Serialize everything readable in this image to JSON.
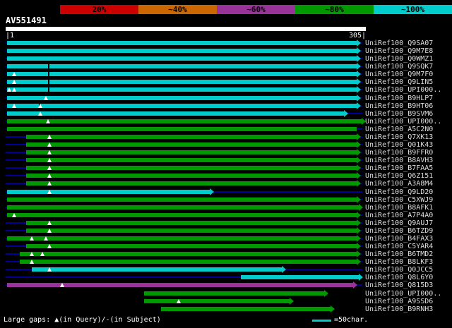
{
  "query": {
    "name": "AV551491",
    "start_label": "|1",
    "end_label": "305|"
  },
  "legend": {
    "gaps_text": "Large gaps: ▲(in Query)/-(in Subject)",
    "scale_text": "=50char."
  },
  "palette": {
    "cyan": "#00CCCC",
    "green": "#009900",
    "purple": "#993399",
    "red": "#CC0000",
    "orange": "#CC6600",
    "navy": "#000099",
    "background": "#000000",
    "query_bar": "#FFFFFF"
  },
  "chart_data": {
    "type": "bar",
    "orientation": "horizontal",
    "query_name": "AV551491",
    "x_range": [
      1,
      305
    ],
    "identity_key": [
      {
        "label": "20%",
        "color": "#CC0000"
      },
      {
        "label": "~40%",
        "color": "#CC6600"
      },
      {
        "label": "~60%",
        "color": "#993399"
      },
      {
        "label": "~80%",
        "color": "#009900"
      },
      {
        "label": "~100%",
        "color": "#00CCCC"
      }
    ],
    "hits": [
      {
        "label": "UniRef100_Q9SA07",
        "color": "cyan",
        "from": 1,
        "to": 299,
        "arrow": true,
        "tri": [],
        "gap": []
      },
      {
        "label": "UniRef100_Q9M7E8",
        "color": "cyan",
        "from": 1,
        "to": 299,
        "arrow": true,
        "tri": [],
        "gap": []
      },
      {
        "label": "UniRef100_Q0WMZ1",
        "color": "cyan",
        "from": 1,
        "to": 299,
        "arrow": true,
        "tri": [],
        "gap": []
      },
      {
        "label": "UniRef100_Q9SQK7",
        "color": "cyan",
        "from": 1,
        "to": 299,
        "arrow": true,
        "tri": [],
        "gap": [
          36
        ]
      },
      {
        "label": "UniRef100_Q9M7F0",
        "color": "cyan",
        "from": 1,
        "to": 299,
        "arrow": true,
        "tri": [
          7
        ],
        "gap": [
          36
        ]
      },
      {
        "label": "UniRef100_Q9LIN5",
        "color": "cyan",
        "from": 1,
        "to": 299,
        "arrow": true,
        "tri": [
          7
        ],
        "gap": [
          36
        ]
      },
      {
        "label": "UniRef100_UPI000..",
        "color": "cyan",
        "from": 1,
        "to": 299,
        "arrow": true,
        "tri": [
          3,
          7
        ],
        "gap": [
          36
        ]
      },
      {
        "label": "UniRef100_B9HLP7",
        "color": "cyan",
        "from": 1,
        "to": 299,
        "arrow": true,
        "tri": [
          34
        ],
        "gap": []
      },
      {
        "label": "UniRef100_B9HT06",
        "color": "cyan",
        "from": 1,
        "to": 299,
        "arrow": true,
        "tri": [
          7,
          29
        ],
        "gap": [
          28
        ]
      },
      {
        "label": "UniRef100_B9SVM6",
        "color": "cyan",
        "from": 1,
        "to": 288,
        "arrow": true,
        "tri": [
          29
        ],
        "gap": []
      },
      {
        "label": "UniRef100_UPI000..",
        "color": "green",
        "from": 1,
        "to": 303,
        "arrow": true,
        "tri": [
          36
        ],
        "gap": []
      },
      {
        "label": "UniRef100_A5C2N0",
        "color": "green",
        "from": 1,
        "to": 299,
        "arrow": false,
        "tri": [],
        "gap": []
      },
      {
        "label": "UniRef100_Q7XK13",
        "color": "green",
        "from": 17,
        "to": 299,
        "arrow": true,
        "tri": [
          37
        ],
        "gap": []
      },
      {
        "label": "UniRef100_Q01K43",
        "color": "green",
        "from": 17,
        "to": 299,
        "arrow": true,
        "tri": [
          37
        ],
        "gap": []
      },
      {
        "label": "UniRef100_B9FFR0",
        "color": "green",
        "from": 17,
        "to": 299,
        "arrow": true,
        "tri": [
          37
        ],
        "gap": []
      },
      {
        "label": "UniRef100_B8AVH3",
        "color": "green",
        "from": 17,
        "to": 299,
        "arrow": true,
        "tri": [
          37
        ],
        "gap": []
      },
      {
        "label": "UniRef100_B7FAA5",
        "color": "green",
        "from": 17,
        "to": 299,
        "arrow": true,
        "tri": [
          37
        ],
        "gap": []
      },
      {
        "label": "UniRef100_Q6Z151",
        "color": "green",
        "from": 17,
        "to": 299,
        "arrow": true,
        "tri": [
          37
        ],
        "gap": []
      },
      {
        "label": "UniRef100_A3A8M4",
        "color": "green",
        "from": 17,
        "to": 299,
        "arrow": true,
        "tri": [
          37
        ],
        "gap": []
      },
      {
        "label": "UniRef100_Q9LD20",
        "color": "cyan",
        "from": 1,
        "to": 174,
        "arrow": true,
        "tri": [
          37
        ],
        "gap": []
      },
      {
        "label": "UniRef100_C5XWJ9",
        "color": "green",
        "from": 1,
        "to": 299,
        "arrow": true,
        "tri": [],
        "gap": []
      },
      {
        "label": "UniRef100_B8AFK1",
        "color": "green",
        "from": 1,
        "to": 301,
        "arrow": true,
        "tri": [],
        "gap": []
      },
      {
        "label": "UniRef100_A7P4A0",
        "color": "green",
        "from": 1,
        "to": 299,
        "arrow": true,
        "tri": [
          7
        ],
        "gap": []
      },
      {
        "label": "UniRef100_Q9AUJ7",
        "color": "green",
        "from": 17,
        "to": 299,
        "arrow": true,
        "tri": [
          37
        ],
        "gap": []
      },
      {
        "label": "UniRef100_B6TZD9",
        "color": "green",
        "from": 17,
        "to": 299,
        "arrow": true,
        "tri": [
          37
        ],
        "gap": []
      },
      {
        "label": "UniRef100_B4FAX3",
        "color": "green",
        "from": 1,
        "to": 299,
        "arrow": true,
        "tri": [
          22,
          34
        ],
        "gap": []
      },
      {
        "label": "UniRef100_C5YAR4",
        "color": "green",
        "from": 17,
        "to": 299,
        "arrow": true,
        "tri": [
          37
        ],
        "gap": []
      },
      {
        "label": "UniRef100_B6TMD2",
        "color": "green",
        "from": 12,
        "to": 299,
        "arrow": true,
        "tri": [
          22,
          31
        ],
        "gap": []
      },
      {
        "label": "UniRef100_B8LKF3",
        "color": "green",
        "from": 12,
        "to": 299,
        "arrow": true,
        "tri": [
          22
        ],
        "gap": []
      },
      {
        "label": "UniRef100_Q0JCC5",
        "color": "cyan",
        "from": 22,
        "to": 235,
        "arrow": true,
        "tri": [
          37
        ],
        "gap": []
      },
      {
        "label": "UniRef100_Q8L6Y0",
        "color": "cyan",
        "from": 200,
        "to": 301,
        "arrow": true,
        "tri": [],
        "gap": []
      },
      {
        "label": "UniRef100_Q815D3",
        "color": "purple",
        "from": 1,
        "to": 296,
        "arrow": true,
        "tri": [
          48
        ],
        "gap": []
      },
      {
        "label": "UniRef100_UPI000..",
        "color": "green",
        "from": 118,
        "to": 271,
        "arrow": true,
        "tri": [],
        "gap": [],
        "line": false
      },
      {
        "label": "UniRef100_A9SSD6",
        "color": "green",
        "from": 118,
        "to": 242,
        "arrow": true,
        "tri": [
          147
        ],
        "gap": [],
        "line": false
      },
      {
        "label": "UniRef100_B9RNH3",
        "color": "green",
        "from": 132,
        "to": 277,
        "arrow": true,
        "tri": [],
        "gap": [],
        "line": false
      }
    ]
  }
}
